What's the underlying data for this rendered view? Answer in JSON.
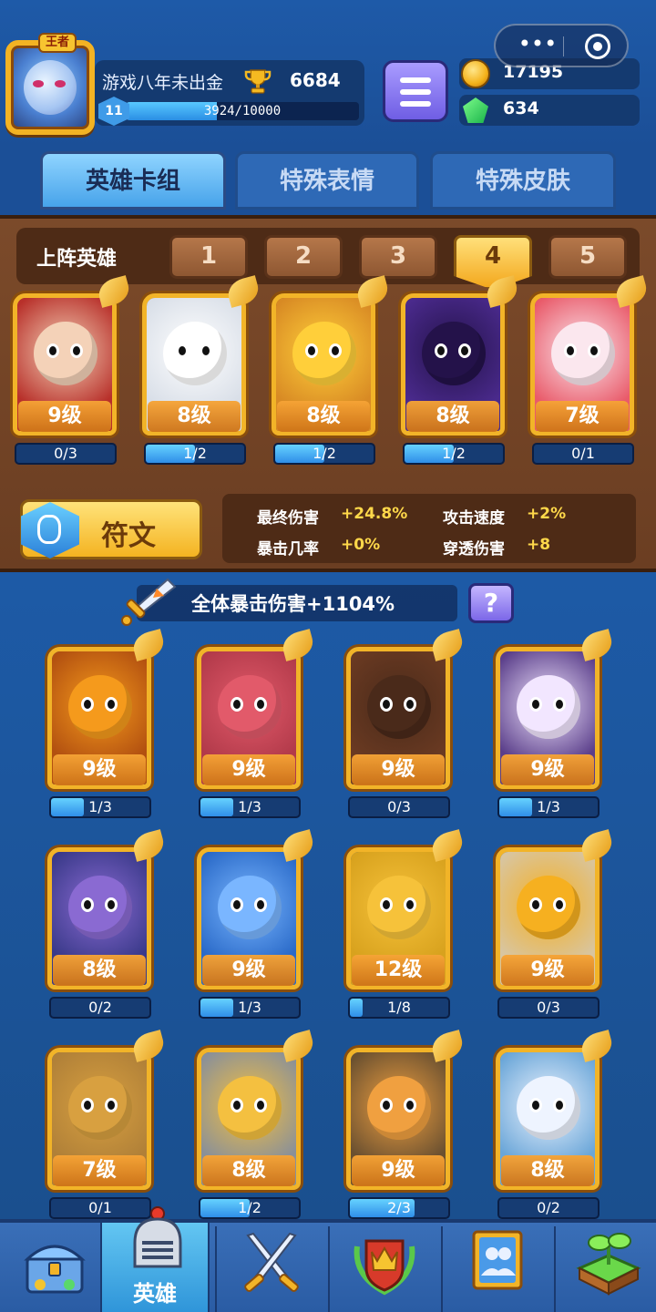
{
  "header": {
    "player_name": "游戏八年未出金",
    "avatar_badge": "王者",
    "trophies": "6684",
    "level": "11",
    "xp_text": "3924/10000",
    "xp_fraction": 0.3924,
    "gold": "17195",
    "gems": "634",
    "capsule_more": "•••"
  },
  "tabs": [
    {
      "label": "英雄卡组",
      "active": true
    },
    {
      "label": "特殊表情",
      "active": false
    },
    {
      "label": "特殊皮肤",
      "active": false
    }
  ],
  "deck": {
    "label": "上阵英雄",
    "deck_tabs": [
      "1",
      "2",
      "3",
      "4",
      "5"
    ],
    "active_deck": "4",
    "cards": [
      {
        "level": "9级",
        "progress": "0/3",
        "fill": 0.0,
        "theme": "lady-fan"
      },
      {
        "level": "8级",
        "progress": "1/2",
        "fill": 0.5,
        "theme": "ghost"
      },
      {
        "level": "8级",
        "progress": "1/2",
        "fill": 0.5,
        "theme": "chef"
      },
      {
        "level": "8级",
        "progress": "1/2",
        "fill": 0.5,
        "theme": "dark-mage"
      },
      {
        "level": "7级",
        "progress": "0/1",
        "fill": 0.0,
        "theme": "clown"
      }
    ]
  },
  "rune": {
    "label": "符文"
  },
  "stats": [
    {
      "label": "最终伤害",
      "value": "+24.8%"
    },
    {
      "label": "攻击速度",
      "value": "+2%"
    },
    {
      "label": "暴击几率",
      "value": "+0%"
    },
    {
      "label": "穿透伤害",
      "value": "+8"
    }
  ],
  "collection": {
    "crit_text": "全体暴击伤害+1104%",
    "help_label": "?",
    "cards": [
      {
        "level": "9级",
        "progress": "1/3",
        "fill": 0.33,
        "theme": "pumpkin"
      },
      {
        "level": "9级",
        "progress": "1/3",
        "fill": 0.33,
        "theme": "monocle"
      },
      {
        "level": "9级",
        "progress": "0/3",
        "fill": 0.0,
        "theme": "lava"
      },
      {
        "level": "9级",
        "progress": "1/3",
        "fill": 0.33,
        "theme": "skull"
      },
      {
        "level": "8级",
        "progress": "0/2",
        "fill": 0.0,
        "theme": "octopus"
      },
      {
        "level": "9级",
        "progress": "1/3",
        "fill": 0.33,
        "theme": "wizard-blue"
      },
      {
        "level": "12级",
        "progress": "1/8",
        "fill": 0.125,
        "theme": "laurel"
      },
      {
        "level": "9级",
        "progress": "0/3",
        "fill": 0.0,
        "theme": "hood"
      },
      {
        "level": "7级",
        "progress": "0/1",
        "fill": 0.0,
        "theme": "wood"
      },
      {
        "level": "8级",
        "progress": "1/2",
        "fill": 0.5,
        "theme": "knight"
      },
      {
        "level": "9级",
        "progress": "2/3",
        "fill": 0.66,
        "theme": "soldier"
      },
      {
        "level": "8级",
        "progress": "0/2",
        "fill": 0.0,
        "theme": "zeus"
      }
    ]
  },
  "nav": [
    {
      "name": "chest",
      "label": ""
    },
    {
      "name": "heroes",
      "label": "英雄",
      "active": true
    },
    {
      "name": "battle",
      "label": ""
    },
    {
      "name": "rank",
      "label": ""
    },
    {
      "name": "social",
      "label": ""
    },
    {
      "name": "farm",
      "label": ""
    }
  ],
  "themes": {
    "lady-fan": {
      "bg": "#b8302a",
      "face": "#f4d2b8"
    },
    "ghost": {
      "bg": "#d9dfe8",
      "face": "#ffffff"
    },
    "chef": {
      "bg": "#d88a24",
      "face": "#ffcf3a"
    },
    "dark-mage": {
      "bg": "#4a2a8c",
      "face": "#24124a"
    },
    "clown": {
      "bg": "#e95b6a",
      "face": "#fbe7ee"
    },
    "pumpkin": {
      "bg": "#b25010",
      "face": "#f59a1c"
    },
    "monocle": {
      "bg": "#b23a4a",
      "face": "#e25a6a"
    },
    "lava": {
      "bg": "#6a3a22",
      "face": "#4a2a1a"
    },
    "skull": {
      "bg": "#5a3e8a",
      "face": "#f2e6ff"
    },
    "octopus": {
      "bg": "#3a3a8a",
      "face": "#8a6ad2"
    },
    "wizard-blue": {
      "bg": "#2a6ac8",
      "face": "#7ab6ff"
    },
    "laurel": {
      "bg": "#d8a21e",
      "face": "#f6c23a"
    },
    "hood": {
      "bg": "#d8c5a0",
      "face": "#f6b020"
    },
    "wood": {
      "bg": "#b08038",
      "face": "#d8a040"
    },
    "knight": {
      "bg": "#8a9098",
      "face": "#f4c040"
    },
    "soldier": {
      "bg": "#6a5030",
      "face": "#f0a040"
    },
    "zeus": {
      "bg": "#6aa6d8",
      "face": "#eef4ff"
    }
  },
  "colors": {
    "accent_gold": "#f2b428",
    "stat_value": "#ffd84a",
    "xp_blue": "#2a8ee4"
  }
}
